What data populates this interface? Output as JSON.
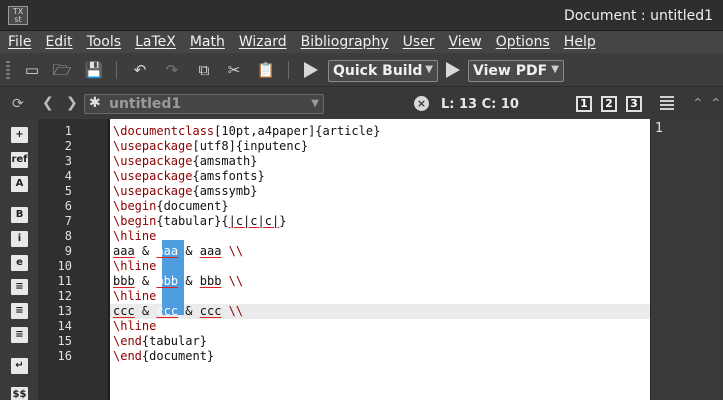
{
  "window": {
    "app_icon_text": "TeX\nstud",
    "title": "Document : untitled1"
  },
  "menu": [
    "File",
    "Edit",
    "Tools",
    "LaTeX",
    "Math",
    "Wizard",
    "Bibliography",
    "User",
    "View",
    "Options",
    "Help"
  ],
  "toolbar": {
    "quick_build_label": "Quick Build",
    "view_pdf_label": "View PDF"
  },
  "tabbar": {
    "document_name": "untitled1",
    "cursor_position": "L: 13 C: 10",
    "view_buttons": [
      "1",
      "2",
      "3"
    ]
  },
  "structure": {
    "line_number": "1"
  },
  "editor": {
    "line_numbers": [
      "1",
      "2",
      "3",
      "4",
      "5",
      "6",
      "7",
      "8",
      "9",
      "10",
      "11",
      "12",
      "13",
      "14",
      "15",
      "16"
    ],
    "lines": [
      "\\documentclass[10pt,a4paper]{article}",
      "\\usepackage[utf8]{inputenc}",
      "\\usepackage{amsmath}",
      "\\usepackage{amsfonts}",
      "\\usepackage{amssymb}",
      "\\begin{document}",
      "\\begin{tabular}{|c|c|c|}",
      "\\hline",
      "aaa & aaa & aaa \\\\",
      "\\hline",
      "bbb & bbb & bbb \\\\",
      "\\hline",
      "ccc & ccc & ccc \\\\",
      "\\hline",
      "\\end{tabular}",
      "\\end{document}"
    ],
    "current_line": 13,
    "selection_color": "#4d9de0"
  },
  "colors": {
    "command": "#8b0000",
    "spellcheck": "#e02020",
    "chrome": "#3a3a3a"
  }
}
